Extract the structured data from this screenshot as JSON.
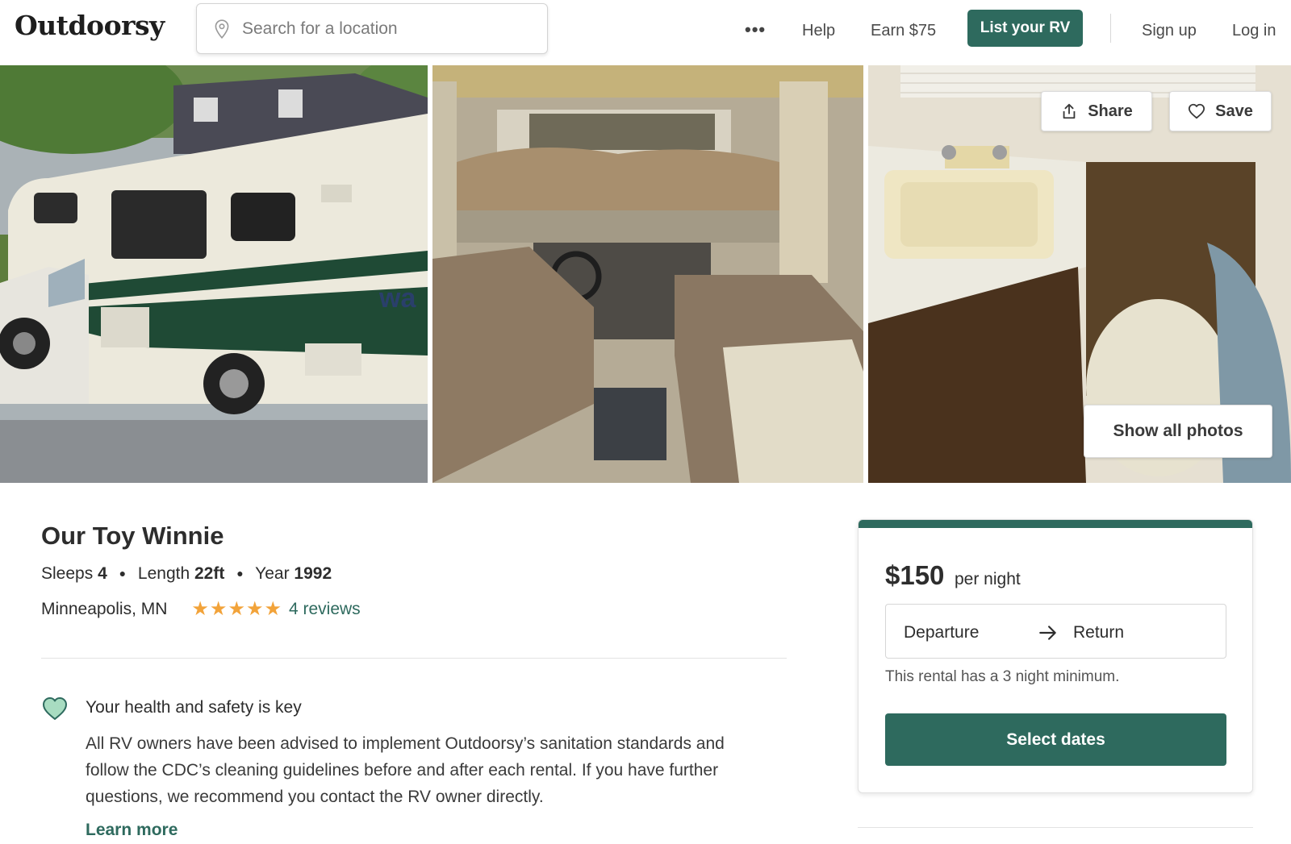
{
  "header": {
    "logo": "Outdoorsy",
    "search_placeholder": "Search for a location",
    "more": "•••",
    "help": "Help",
    "earn": "Earn $75",
    "list_rv": "List your RV",
    "sign_up": "Sign up",
    "log_in": "Log in"
  },
  "gallery": {
    "share": "Share",
    "save": "Save",
    "show_all": "Show all photos",
    "photos": [
      "exterior",
      "interior-cab",
      "bathroom"
    ]
  },
  "listing": {
    "title": "Our Toy Winnie",
    "sleeps_label": "Sleeps",
    "sleeps": "4",
    "length_label": "Length",
    "length": "22ft",
    "year_label": "Year",
    "year": "1992",
    "location": "Minneapolis, MN",
    "rating": 5,
    "reviews": "4 reviews"
  },
  "health": {
    "title": "Your health and safety is key",
    "text": "All RV owners have been advised to implement Outdoorsy’s sanitation standards and follow the CDC’s cleaning guidelines before and after each rental. If you have further questions, we recommend you contact the RV owner directly.",
    "learn_more": "Learn more"
  },
  "booking": {
    "price": "$150",
    "per_night": "per night",
    "departure": "Departure",
    "return": "Return",
    "minimum_note": "This rental has a 3 night minimum.",
    "select_dates": "Select dates"
  },
  "colors": {
    "brand": "#2e6a5e",
    "star": "#f2a33a"
  }
}
